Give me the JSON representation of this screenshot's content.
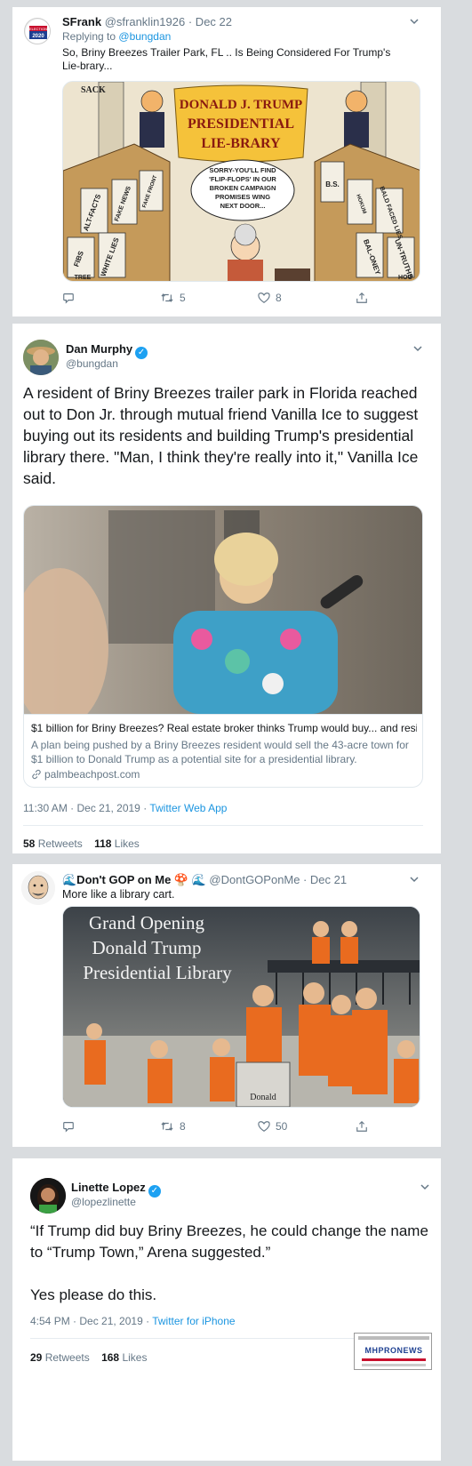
{
  "tweet1": {
    "name": "SFrank",
    "handle": "@sfranklin1926",
    "date": "· Dec 22",
    "replying_prefix": "Replying to",
    "replying_to": "@bungdan",
    "text": "So, Briny Breezes Trailer Park, FL .. Is Being Considered For Trump's Lie-brary...",
    "avatar_text": "ELECTION 2020",
    "cartoon": {
      "signature": "SACK",
      "banner": [
        "DONALD J. TRUMP",
        "PRESIDENTIAL",
        "LIE-BRARY"
      ],
      "bubble": [
        "SORRY-YOU'LL FIND",
        "'FLIP-FLOPS' IN OUR",
        "BROKEN CAMPAIGN",
        "PROMISES WING",
        "NEXT DOOR..."
      ],
      "books_left": [
        "FAKE NEWS",
        "ALT-FACTS",
        "WHITE LIES",
        "FIBS",
        "TREE",
        "FAKE FRONT"
      ],
      "books_right": [
        "B.S.",
        "BALD FACED LIES",
        "HOKUM",
        "BAL-ONEY",
        "UN-TRUTHS",
        "HOO"
      ]
    },
    "counts": {
      "reply": "",
      "retweet": "5",
      "like": "8"
    }
  },
  "tweet2": {
    "name": "Dan Murphy",
    "handle": "@bungdan",
    "text": "A resident of Briny Breezes trailer park in Florida reached out to Don Jr. through mutual friend Vanilla Ice to suggest buying out its residents and building Trump's presidential library there. \"Man, I think they're really into it,\" Vanilla Ice said.",
    "card_title": "$1 billion for Briny Breezes? Real estate broker thinks Trump would buy... and resi...",
    "card_desc": "A plan being pushed by a Briny Breezes resident would sell the 43-acre town for $1 billion to Donald Trump as a potential site for a presidential library.",
    "card_domain": "palmbeachpost.com",
    "time": "11:30 AM · Dec 21, 2019 · ",
    "source": "Twitter Web App",
    "retweets_count": "58",
    "retweets_label": "Retweets",
    "likes_count": "118",
    "likes_label": "Likes"
  },
  "tweet3": {
    "name": "🌊Don't GOP on Me 🍄 🌊",
    "handle": "@DontGOPonMe",
    "date": "· Dec 21",
    "text": "More like a library cart.",
    "image_lines": [
      "Grand Opening",
      "Donald Trump",
      "Presidential Library"
    ],
    "cart_label": "Donald",
    "counts": {
      "reply": "",
      "retweet": "8",
      "like": "50"
    }
  },
  "tweet4": {
    "name": "Linette Lopez",
    "handle": "@lopezlinette",
    "text_line1": "“If Trump did buy Briny Breezes, he could change the name to “Trump Town,” Arena suggested.”",
    "text_line2": "Yes please do this.",
    "time": "4:54 PM · Dec 21, 2019 · ",
    "source": "Twitter for iPhone",
    "retweets_count": "29",
    "retweets_label": "Retweets",
    "likes_count": "168",
    "likes_label": "Likes",
    "watermark": "MHPRONEWS"
  },
  "colors": {
    "accent": "#1da1f2",
    "link": "#1b95e0",
    "muted": "#657786",
    "divider": "#e6ecf0",
    "background": "#d9dcdf"
  },
  "icons": [
    "chevron-down-icon",
    "reply-icon",
    "retweet-icon",
    "like-icon",
    "share-icon",
    "link-icon",
    "verified-icon"
  ]
}
